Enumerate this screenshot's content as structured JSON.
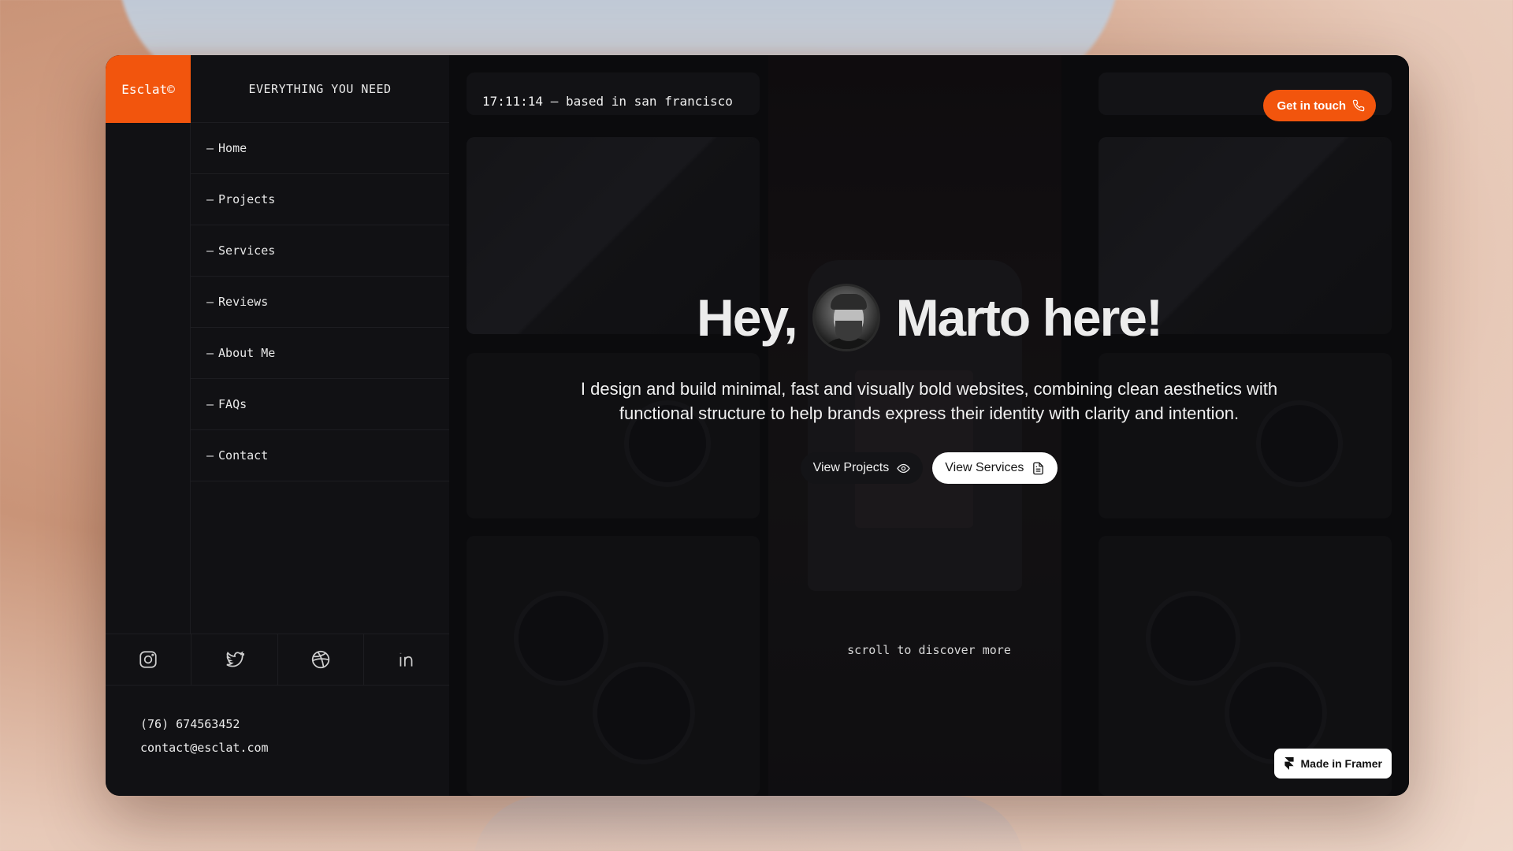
{
  "brand": {
    "name": "Esclat©",
    "accent": "#f2550d"
  },
  "sidebar": {
    "tagline": "EVERYTHING YOU NEED",
    "items": [
      {
        "label": "Home"
      },
      {
        "label": "Projects"
      },
      {
        "label": "Services"
      },
      {
        "label": "Reviews"
      },
      {
        "label": "About Me"
      },
      {
        "label": "FAQs"
      },
      {
        "label": "Contact"
      }
    ],
    "dash": "—",
    "socials": [
      "instagram-icon",
      "twitter-icon",
      "dribbble-icon",
      "linkedin-icon"
    ],
    "phone": "(76) 674563452",
    "email": "contact@esclat.com"
  },
  "header": {
    "status": "17:11:14 — based in san francisco",
    "cta_label": "Get in touch",
    "cta_icon": "phone-icon"
  },
  "hero": {
    "greeting": "Hey,",
    "name_line": "Marto here!",
    "subtitle": "I design and build minimal, fast and visually bold websites, combining clean aesthetics with functional structure to help brands express their identity with clarity and intention.",
    "btn_projects": "View Projects",
    "btn_services": "View Services",
    "scroll_hint": "scroll to discover more"
  },
  "badge": {
    "label": "Made in Framer"
  }
}
